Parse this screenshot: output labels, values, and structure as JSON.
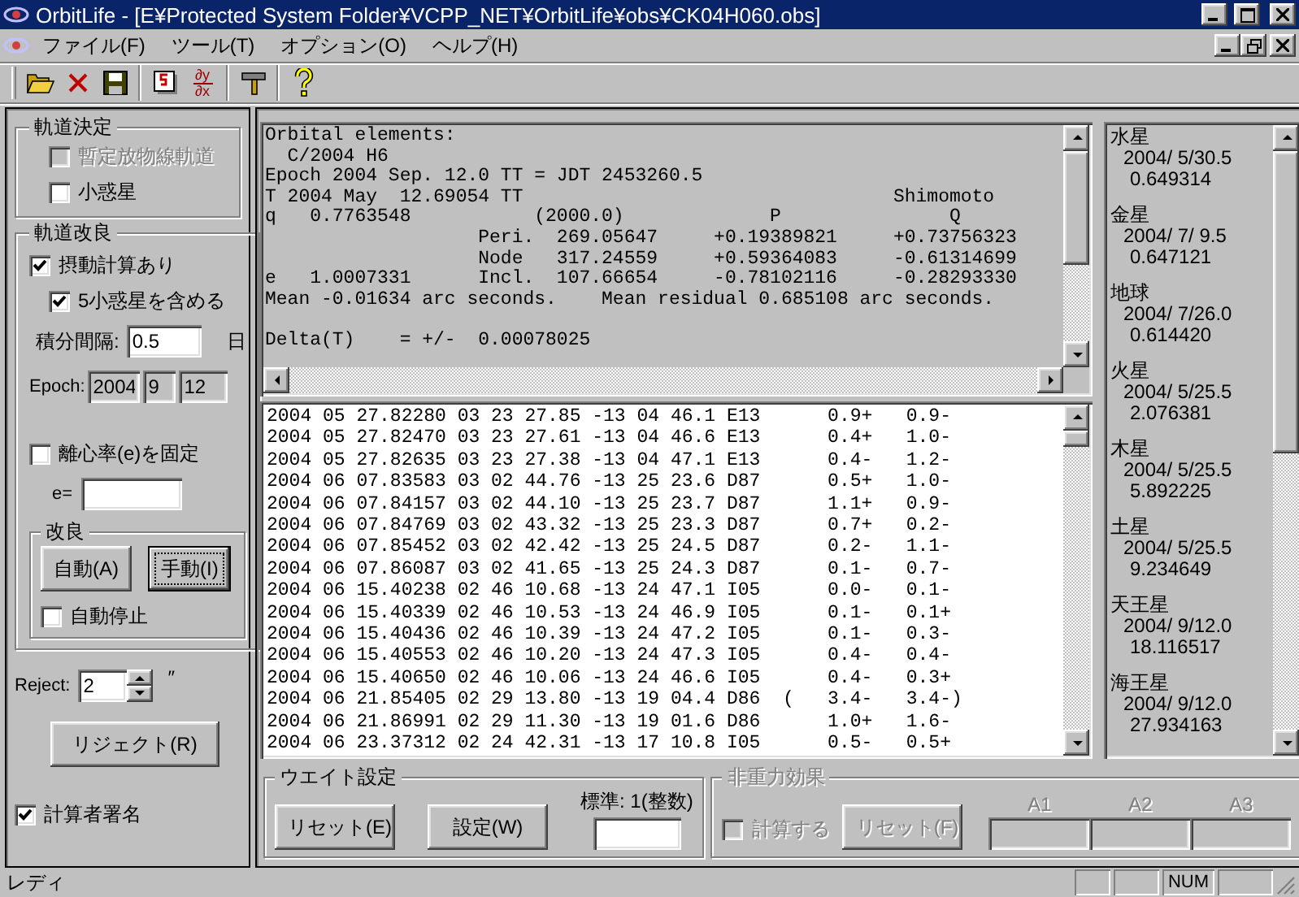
{
  "window": {
    "title": "OrbitLife - [E¥Protected System Folder¥VCPP_NET¥OrbitLife¥obs¥CK04H060.obs]"
  },
  "menu": [
    "ファイル(F)",
    "ツール(T)",
    "オプション(O)",
    "ヘルプ(H)"
  ],
  "toolbar": [
    [
      {
        "kind": "open"
      },
      {
        "kind": "delete"
      },
      {
        "kind": "save"
      }
    ],
    [
      {
        "kind": "calendar"
      },
      {
        "kind": "derivative",
        "top": "∂y",
        "bottom": "∂x"
      }
    ],
    [
      {
        "kind": "tool"
      }
    ],
    [
      {
        "kind": "help"
      }
    ]
  ],
  "orbit_determination": {
    "title": "軌道決定",
    "options": [
      {
        "label": "暫定放物線軌道",
        "checked": false,
        "disabled": true
      },
      {
        "label": "小惑星",
        "checked": false,
        "disabled": false
      }
    ]
  },
  "orbit_improvement": {
    "title": "軌道改良",
    "perturbation": {
      "label": "摂動計算あり",
      "checked": true
    },
    "include_asteroids": {
      "label": "5小惑星を含める",
      "checked": true
    },
    "step": {
      "label": "積分間隔:",
      "value": "0.5",
      "unit": "日"
    },
    "epoch": {
      "label": "Epoch:",
      "values": [
        "2004",
        "9",
        "12"
      ],
      "disabled": true
    },
    "fix_e": {
      "label": "離心率(e)を固定",
      "checked": false
    },
    "e_field": {
      "label": "e="
    },
    "improve": {
      "title": "改良",
      "buttons": [
        {
          "label": "自動(A)",
          "default": false
        },
        {
          "label": "手動(I)",
          "default": true
        }
      ],
      "auto_stop": {
        "label": "自動停止",
        "checked": false
      }
    }
  },
  "reject": {
    "label": "Reject:",
    "value": "2",
    "unit": "″",
    "button": "リジェクト(R)"
  },
  "signature": {
    "label": "計算者署名",
    "checked": true
  },
  "elements": {
    "lines": [
      "Orbital elements:",
      "  C/2004 H6",
      "Epoch 2004 Sep. 12.0 TT = JDT 2453260.5",
      "T 2004 May  12.69054 TT                                 Shimomoto",
      "q   0.7763548           (2000.0)             P               Q",
      "                   Peri.  269.05647     +0.19389821     +0.73756323",
      "                   Node   317.24559     +0.59364083     -0.61314699",
      "e   1.0007331      Incl.  107.66654     -0.78102116     -0.28293330",
      "Mean -0.01634 arc seconds.    Mean residual 0.685108 arc seconds."
    ],
    "delta": "Delta(T)    = +/-  0.00078025"
  },
  "observations": [
    "2004 05 27.82280 03 23 27.85 -13 04 46.1 E13      0.9+   0.9-",
    "2004 05 27.82470 03 23 27.61 -13 04 46.6 E13      0.4+   1.0-",
    "2004 05 27.82635 03 23 27.38 -13 04 47.1 E13      0.4-   1.2-",
    "2004 06 07.83583 03 02 44.76 -13 25 23.6 D87      0.5+   1.0-",
    "2004 06 07.84157 03 02 44.10 -13 25 23.7 D87      1.1+   0.9-",
    "2004 06 07.84769 03 02 43.32 -13 25 23.3 D87      0.7+   0.2-",
    "2004 06 07.85452 03 02 42.42 -13 25 24.5 D87      0.2-   1.1-",
    "2004 06 07.86087 03 02 41.65 -13 25 24.3 D87      0.1-   0.7-",
    "2004 06 15.40238 02 46 10.68 -13 24 47.1 I05      0.0-   0.1-",
    "2004 06 15.40339 02 46 10.53 -13 24 46.9 I05      0.1-   0.1+",
    "2004 06 15.40436 02 46 10.39 -13 24 47.2 I05      0.1-   0.3-",
    "2004 06 15.40553 02 46 10.20 -13 24 47.3 I05      0.4-   0.4-",
    "2004 06 15.40650 02 46 10.06 -13 24 46.6 I05      0.4-   0.3+",
    "2004 06 21.85405 02 29 13.80 -13 19 04.4 D86  (   3.4-   3.4-)",
    "2004 06 21.86991 02 29 11.30 -13 19 01.6 D86      1.0+   1.6-",
    "2004 06 23.37312 02 24 42.31 -13 17 10.8 I05      0.5-   0.5+"
  ],
  "planets": [
    {
      "name": "水星",
      "date": "2004/ 5/30.5",
      "value": "0.649314"
    },
    {
      "name": "金星",
      "date": "2004/ 7/ 9.5",
      "value": "0.647121"
    },
    {
      "name": "地球",
      "date": "2004/ 7/26.0",
      "value": "0.614420"
    },
    {
      "name": "火星",
      "date": "2004/ 5/25.5",
      "value": "2.076381"
    },
    {
      "name": "木星",
      "date": "2004/ 5/25.5",
      "value": "5.892225"
    },
    {
      "name": "土星",
      "date": "2004/ 5/25.5",
      "value": "9.234649"
    },
    {
      "name": "天王星",
      "date": "2004/ 9/12.0",
      "value": "18.116517"
    },
    {
      "name": "海王星",
      "date": "2004/ 9/12.0",
      "value": "27.934163"
    }
  ],
  "weight": {
    "title": "ウエイト設定",
    "buttons": [
      "リセット(E)",
      "設定(W)"
    ],
    "standard_label": "標準: 1(整数)"
  },
  "nongrav": {
    "title": "非重力効果",
    "disabled": true,
    "compute": {
      "label": "計算する",
      "checked": false
    },
    "button": "リセット(F)",
    "params": [
      "A1",
      "A2",
      "A3"
    ]
  },
  "status_bar": {
    "text": "レディ",
    "indicators": [
      "NUM"
    ]
  }
}
